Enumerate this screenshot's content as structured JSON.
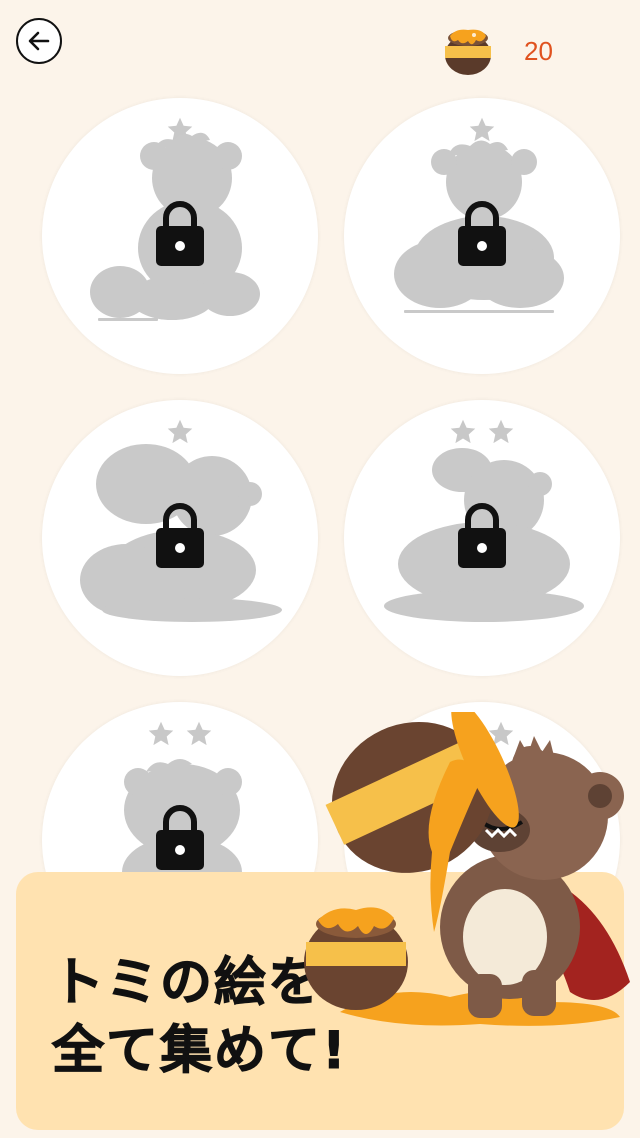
{
  "header": {
    "back_icon": "arrow-left-icon",
    "currency_icon": "honey-pot-icon",
    "honey_count": "20"
  },
  "gallery": {
    "cards": [
      {
        "stars": 1,
        "locked": true
      },
      {
        "stars": 1,
        "locked": true
      },
      {
        "stars": 1,
        "locked": true
      },
      {
        "stars": 2,
        "locked": true
      },
      {
        "stars": 2,
        "locked": true
      },
      {
        "stars": 2,
        "locked": true
      }
    ]
  },
  "promo": {
    "line1": "トミの絵を",
    "line2": "全て集めて!"
  },
  "colors": {
    "background": "#FCF4EA",
    "banner": "#FFE2B0",
    "counter": "#E0521F",
    "silhouette": "#C9C9C9",
    "star": "#C8C8C8"
  }
}
